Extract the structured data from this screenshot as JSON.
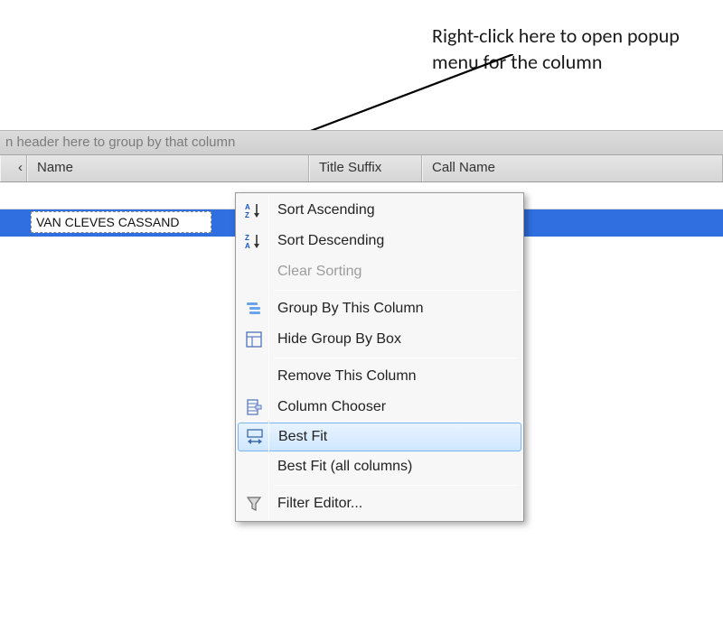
{
  "annotation": {
    "text": "Right-click here to open popup menu for the column"
  },
  "grid": {
    "group_panel_text": "n header here to group by that column",
    "columns": {
      "stub": "‹",
      "name": "Name",
      "title_suffix": "Title Suffix",
      "call_name": "Call Name"
    },
    "rows": [
      {
        "blank": true
      },
      {
        "selected": true,
        "name_cell": "VAN CLEVES CASSAND"
      }
    ]
  },
  "context_menu": {
    "items": [
      {
        "id": "sort-asc",
        "label": "Sort Ascending",
        "icon": "sort-asc-icon"
      },
      {
        "id": "sort-desc",
        "label": "Sort Descending",
        "icon": "sort-desc-icon"
      },
      {
        "id": "clear-sort",
        "label": "Clear Sorting",
        "icon": null,
        "disabled": true
      },
      {
        "separator": true
      },
      {
        "id": "group-by",
        "label": "Group By This Column",
        "icon": "group-icon"
      },
      {
        "id": "hide-group-box",
        "label": "Hide Group By Box",
        "icon": "grid-box-icon"
      },
      {
        "separator": true
      },
      {
        "id": "remove-col",
        "label": "Remove This Column",
        "icon": null
      },
      {
        "id": "col-chooser",
        "label": "Column Chooser",
        "icon": "chooser-icon"
      },
      {
        "id": "best-fit",
        "label": "Best Fit",
        "icon": "best-fit-icon",
        "highlighted": true
      },
      {
        "id": "best-fit-all",
        "label": "Best Fit (all columns)",
        "icon": null
      },
      {
        "separator": true
      },
      {
        "id": "filter-editor",
        "label": "Filter Editor...",
        "icon": "funnel-icon"
      }
    ]
  }
}
